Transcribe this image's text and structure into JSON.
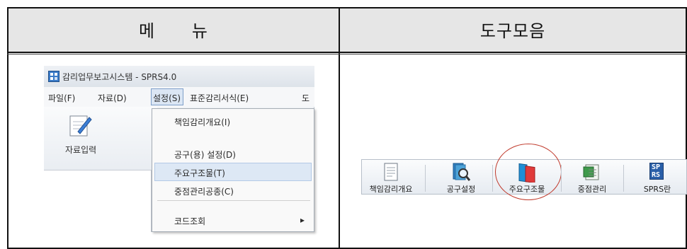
{
  "header": {
    "menu_label": "메      뉴",
    "toolbar_label": "도구모음"
  },
  "app_window": {
    "title": "감리업무보고시스템 - SPRS4.0",
    "menubar": [
      "파일(F)",
      "자료(D)",
      "설정(S)",
      "표준감리서식(E)",
      "도"
    ],
    "ribbon_button": "자료입력",
    "dropdown": {
      "items": [
        "책임감리개요(I)",
        "공구(용) 설정(D)",
        "주요구조물(T)",
        "중점관리공종(C)",
        "코드조회"
      ],
      "highlighted_index": 2,
      "submenu_arrow": "▸"
    }
  },
  "toolbar": {
    "buttons": [
      {
        "label": "책임감리개요",
        "icon": "document-icon"
      },
      {
        "label": "공구설정",
        "icon": "search-document-icon"
      },
      {
        "label": "주요구조물",
        "icon": "books-icon",
        "highlighted": true
      },
      {
        "label": "중점관리",
        "icon": "list-icon"
      },
      {
        "label": "SPRS란",
        "icon": "sprs-logo-icon",
        "icon_text": [
          "SP",
          "RS"
        ]
      }
    ]
  },
  "colors": {
    "highlight_circle": "#c0392b",
    "header_bg": "#e6e6e6",
    "selected_menu": "#dde8f5"
  }
}
